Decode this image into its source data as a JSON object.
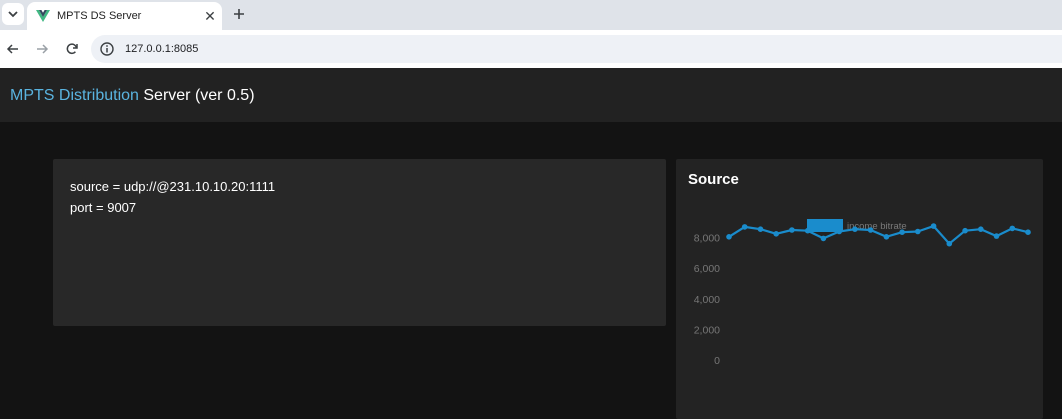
{
  "browser": {
    "tab_title": "MPTS DS Server",
    "url": "127.0.0.1:8085"
  },
  "navbar": {
    "brand_accent": "MPTS Distribution",
    "brand_rest": "Server (ver 0.5)"
  },
  "source_info": {
    "source_line": "source = udp://@231.10.10.20:1111",
    "port_line": "port = 9007"
  },
  "source_panel": {
    "title": "Source"
  },
  "colors": {
    "accent": "#5ab4e0",
    "series": "#1a8ccc",
    "favicon": "#41b883"
  },
  "chart_data": {
    "type": "line",
    "series": [
      {
        "name": "income bitrate",
        "values": [
          8050,
          8700,
          8550,
          8250,
          8500,
          8450,
          7950,
          8400,
          8550,
          8500,
          8050,
          8350,
          8400,
          8750,
          7600,
          8450,
          8550,
          8100,
          8600,
          8350
        ]
      }
    ],
    "yticks": [
      "8,000",
      "6,000",
      "4,000",
      "2,000",
      "0"
    ],
    "ylim": [
      0,
      10000
    ],
    "legend_position": "top"
  }
}
